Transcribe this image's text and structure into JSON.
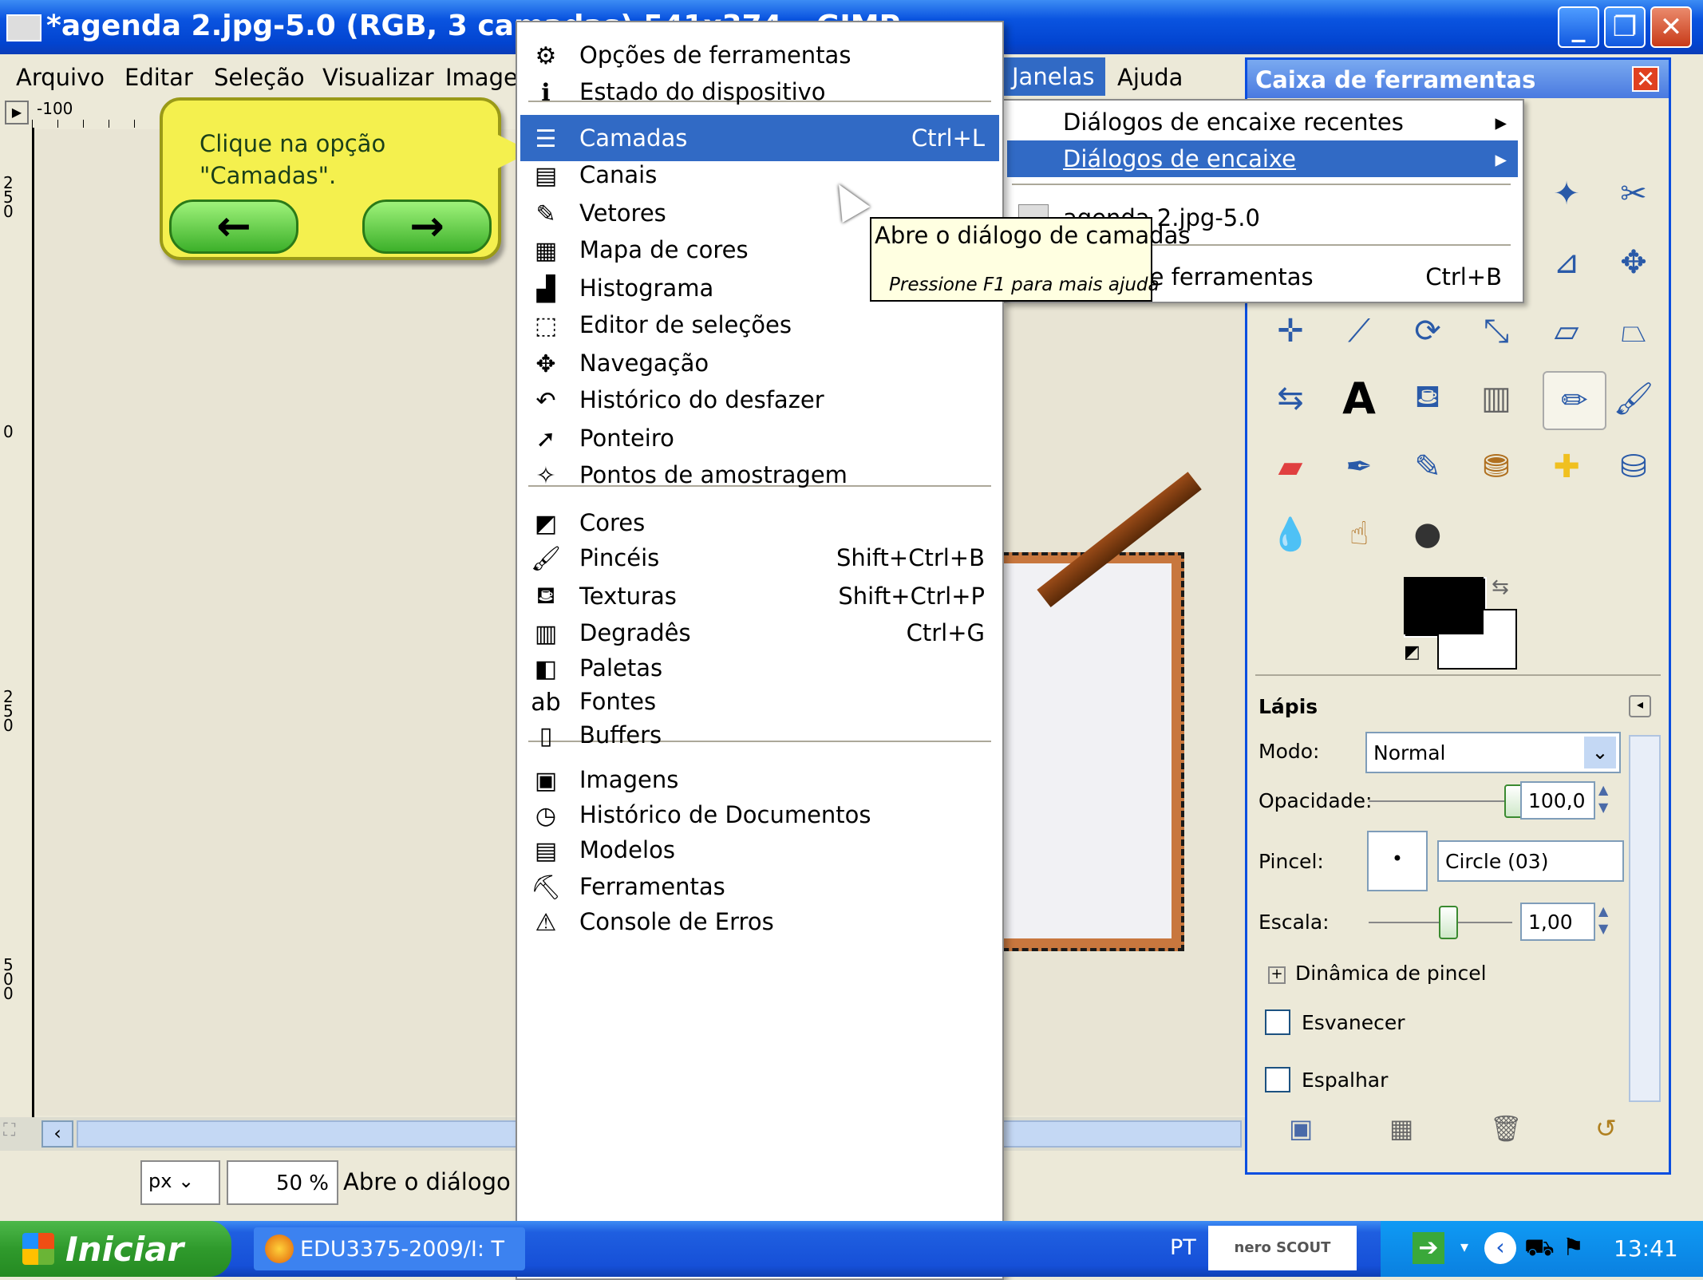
{
  "window": {
    "title": "*agenda 2.jpg-5.0 (RGB, 3 camadas) 541x374 – GIMP"
  },
  "menubar": {
    "items": [
      "Arquivo",
      "Editar",
      "Seleção",
      "Visualizar",
      "Imagem",
      "Janelas",
      "Ajuda"
    ]
  },
  "ruler": {
    "top_label": "-100",
    "left_labels": [
      "250",
      "0",
      "250",
      "500"
    ]
  },
  "callout": {
    "text_line1": "Clique na opção",
    "text_line2": "\"Camadas\".",
    "prev_label": "←",
    "next_label": "→"
  },
  "janelas_menu": {
    "items": [
      {
        "label": "Diálogos de encaixe  recentes"
      },
      {
        "label": "Diálogos de encaixe"
      },
      {
        "label": "agenda 2.jpg-5.0"
      },
      {
        "label": "Caixa de ferramentas",
        "shortcut": "Ctrl+B"
      }
    ]
  },
  "dock_menu": {
    "items": [
      {
        "label": "Opções de ferramentas",
        "shortcut": "",
        "icon": "tool-options-icon",
        "glyph": "⚙"
      },
      {
        "label": "Estado do dispositivo",
        "shortcut": "",
        "icon": "device-status-icon",
        "glyph": "ℹ"
      },
      {
        "label": "Camadas",
        "shortcut": "Ctrl+L",
        "icon": "layers-icon",
        "glyph": "☰"
      },
      {
        "label": "Canais",
        "shortcut": "",
        "icon": "channels-icon",
        "glyph": "▤"
      },
      {
        "label": "Vetores",
        "shortcut": "",
        "icon": "paths-icon",
        "glyph": "✎"
      },
      {
        "label": "Mapa de cores",
        "shortcut": "",
        "icon": "colormap-icon",
        "glyph": "▦"
      },
      {
        "label": "Histograma",
        "shortcut": "",
        "icon": "histogram-icon",
        "glyph": "▟"
      },
      {
        "label": "Editor de seleções",
        "shortcut": "",
        "icon": "selection-editor-icon",
        "glyph": "⬚"
      },
      {
        "label": "Navegação",
        "shortcut": "",
        "icon": "navigation-icon",
        "glyph": "✥"
      },
      {
        "label": "Histórico do desfazer",
        "shortcut": "",
        "icon": "undo-history-icon",
        "glyph": "↶"
      },
      {
        "label": "Ponteiro",
        "shortcut": "",
        "icon": "pointer-icon",
        "glyph": "➚"
      },
      {
        "label": "Pontos de amostragem",
        "shortcut": "",
        "icon": "sample-points-icon",
        "glyph": "✧"
      },
      {
        "label": "Cores",
        "shortcut": "",
        "icon": "colors-icon",
        "glyph": "◩"
      },
      {
        "label": "Pincéis",
        "shortcut": "Shift+Ctrl+B",
        "icon": "brushes-icon",
        "glyph": "🖌"
      },
      {
        "label": "Texturas",
        "shortcut": "Shift+Ctrl+P",
        "icon": "patterns-icon",
        "glyph": "⛾"
      },
      {
        "label": "Degradês",
        "shortcut": "Ctrl+G",
        "icon": "gradients-icon",
        "glyph": "▥"
      },
      {
        "label": "Paletas",
        "shortcut": "",
        "icon": "palettes-icon",
        "glyph": "◧"
      },
      {
        "label": "Fontes",
        "shortcut": "",
        "icon": "fonts-icon",
        "glyph": "ab"
      },
      {
        "label": "Buffers",
        "shortcut": "",
        "icon": "buffers-icon",
        "glyph": "▯"
      },
      {
        "label": "Imagens",
        "shortcut": "",
        "icon": "images-icon",
        "glyph": "▣"
      },
      {
        "label": "Histórico de Documentos",
        "shortcut": "",
        "icon": "document-history-icon",
        "glyph": "◷"
      },
      {
        "label": "Modelos",
        "shortcut": "",
        "icon": "templates-icon",
        "glyph": "▤"
      },
      {
        "label": "Ferramentas",
        "shortcut": "",
        "icon": "tools-icon",
        "glyph": "⛏"
      },
      {
        "label": "Console de Erros",
        "shortcut": "",
        "icon": "error-console-icon",
        "glyph": "⚠"
      }
    ]
  },
  "tooltip": {
    "text": "Abre o diálogo de camadas",
    "help": "Pressione F1 para mais ajuda"
  },
  "statusbar": {
    "unit": "px",
    "zoom": "50 %",
    "message": "Abre o diálogo de camadas"
  },
  "toolbox": {
    "title": "Caixa de ferramentas",
    "tool_options_title": "Lápis",
    "mode_label": "Modo:",
    "mode_value": "Normal",
    "opacity_label": "Opacidade:",
    "opacity_value": "100,0",
    "opacity_fraction": 1.0,
    "brush_label": "Pincel:",
    "brush_value": "Circle (03)",
    "scale_label": "Escala:",
    "scale_value": "1,00",
    "dynamics_label": "Dinâmica de pincel",
    "fade_label": "Esvanecer",
    "jitter_label": "Espalhar"
  },
  "taskbar": {
    "start_label": "Iniciar",
    "task_label": "EDU3375-2009/I: T",
    "language": "PT",
    "clock": "13:41",
    "nero_label": "nero SCOUT"
  },
  "colors": {
    "menu_highlight": "#316ac5",
    "titlebar_blue": "#0244d0",
    "callout_yellow": "#f4f04e"
  }
}
